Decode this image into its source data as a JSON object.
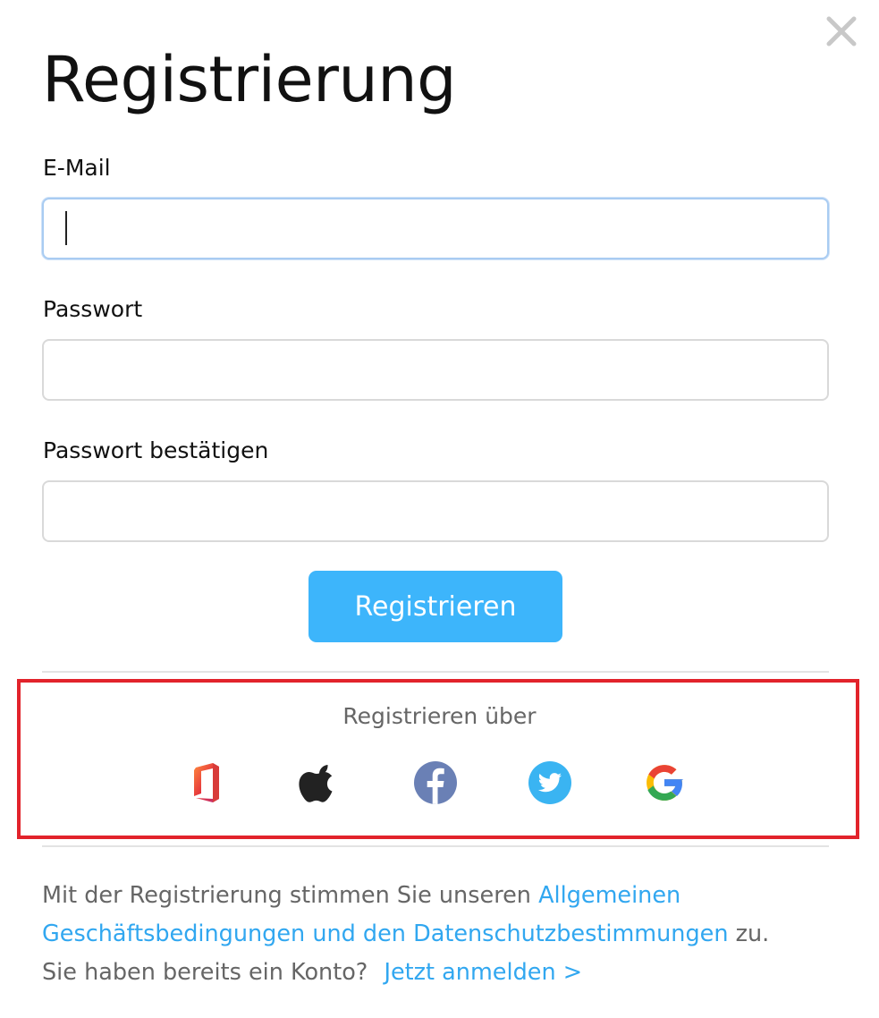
{
  "dialog": {
    "title": "Registrierung",
    "close_icon": "close-icon"
  },
  "form": {
    "email_label": "E-Mail",
    "email_value": "",
    "password_label": "Passwort",
    "password_value": "",
    "confirm_label": "Passwort bestätigen",
    "confirm_value": "",
    "submit_label": "Registrieren"
  },
  "social": {
    "title": "Registrieren über",
    "providers": [
      "office-icon",
      "apple-icon",
      "facebook-icon",
      "twitter-icon",
      "google-icon"
    ]
  },
  "footer": {
    "terms_prefix": "Mit der Registrierung stimmen Sie unseren ",
    "terms_link": "Allgemeinen Geschäftsbedingungen und den Datenschutzbestimmungen",
    "terms_suffix": " zu.",
    "account_text": "Sie haben bereits ein Konto?",
    "login_link": "Jetzt anmelden >"
  },
  "colors": {
    "accent": "#3db5fb",
    "link": "#31a7f0",
    "highlight_border": "#e2232b"
  }
}
